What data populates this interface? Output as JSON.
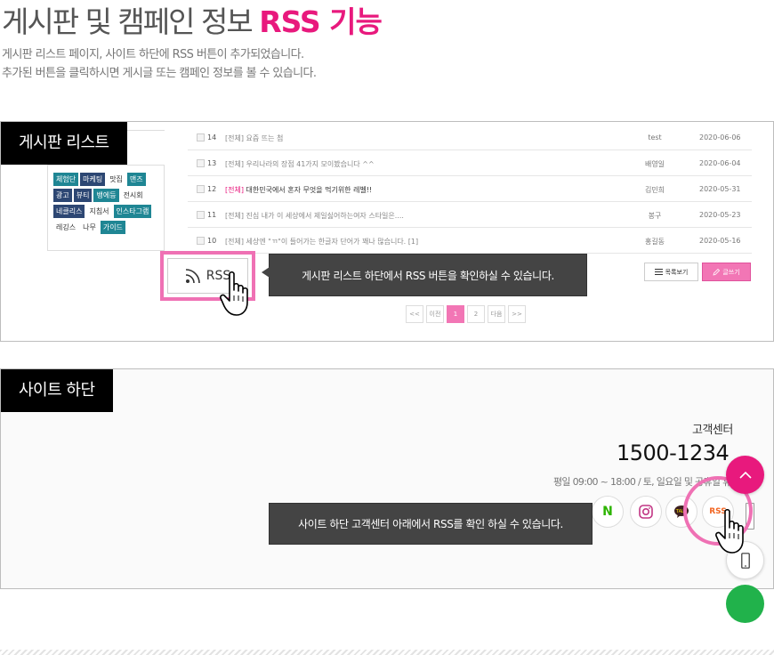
{
  "heading": {
    "main": "게시판 및 캠페인 정보",
    "accent": "RSS 기능"
  },
  "description": {
    "line1": "게시판 리스트 페이지, 사이트 하단에 RSS 버튼이 추가되었습니다.",
    "line2": "추가된 버튼을 클릭하시면 게시글 또는 캠페인 정보를 볼 수 있습니다."
  },
  "board_panel": {
    "label": "게시판 리스트",
    "tags": [
      [
        {
          "text": "체험단",
          "style": "teal"
        },
        {
          "text": "마케팅",
          "style": "navy"
        },
        {
          "text": "맛집",
          "style": "plain"
        },
        {
          "text": "맨즈",
          "style": "teal"
        }
      ],
      [
        {
          "text": "광고",
          "style": "navy"
        },
        {
          "text": "뷰티",
          "style": "navy"
        },
        {
          "text": "뱅에등",
          "style": "teal"
        },
        {
          "text": "전시회",
          "style": "plain"
        }
      ],
      [
        {
          "text": "네클리스",
          "style": "navy"
        },
        {
          "text": "지침서",
          "style": "plain"
        },
        {
          "text": "인스타그램",
          "style": "teal"
        }
      ],
      [
        {
          "text": "레깅스",
          "style": "plain"
        },
        {
          "text": "나무",
          "style": "plain"
        },
        {
          "text": "가이드",
          "style": "teal"
        }
      ]
    ],
    "rows": [
      {
        "num": "14",
        "subject": "[전체] 요즘 뜨는 첨",
        "writer": "test",
        "date": "2020-06-06"
      },
      {
        "num": "13",
        "subject": "[전체] 우리나라의 장점 41가지 모이봤습니다 ^^",
        "writer": "배영일",
        "date": "2020-06-04"
      },
      {
        "num": "12",
        "category": "[전체]",
        "subject": "대한민국에서 혼자 무엇을 먹기위한 레벨!!",
        "writer": "김민희",
        "date": "2020-05-31"
      },
      {
        "num": "11",
        "subject": "[전체] 진심 내가 이 세상에서 제일싫어하는여자 스타일은....",
        "writer": "봉구",
        "date": "2020-05-23"
      },
      {
        "num": "10",
        "subject": "[전체] 세상엔 \"ㄲ\"이 들어가는 한글자 단어가 꽤나 많습니다. [1]",
        "writer": "홍길동",
        "date": "2020-05-16"
      }
    ],
    "rss_button": "RSS",
    "callout": "게시판 리스트 하단에서 RSS 버튼을 확인하실 수 있습니다.",
    "list_button": "목록보기",
    "write_button": "글쓰기",
    "pagination": [
      "<<",
      "이전",
      "1",
      "2",
      "다음",
      ">>"
    ],
    "current_page": "1"
  },
  "footer_panel": {
    "label": "사이트 하단",
    "cs_label": "고객센터",
    "cs_phone": "1500-1234",
    "cs_hours": "평일 09:00 ~ 18:00 / 토, 일요일 및 공휴일 휴무",
    "sns": {
      "naver": "N",
      "rss": "RSS"
    },
    "callout": "사이트 하단 고객센터 아래에서 RSS를 확인 하실 수 있습니다."
  },
  "colors": {
    "accent": "#e8197d",
    "highlight": "#ef71b4",
    "tag_teal": "#1f8694",
    "tag_navy": "#2d4773",
    "rss_orange": "#f26522"
  }
}
